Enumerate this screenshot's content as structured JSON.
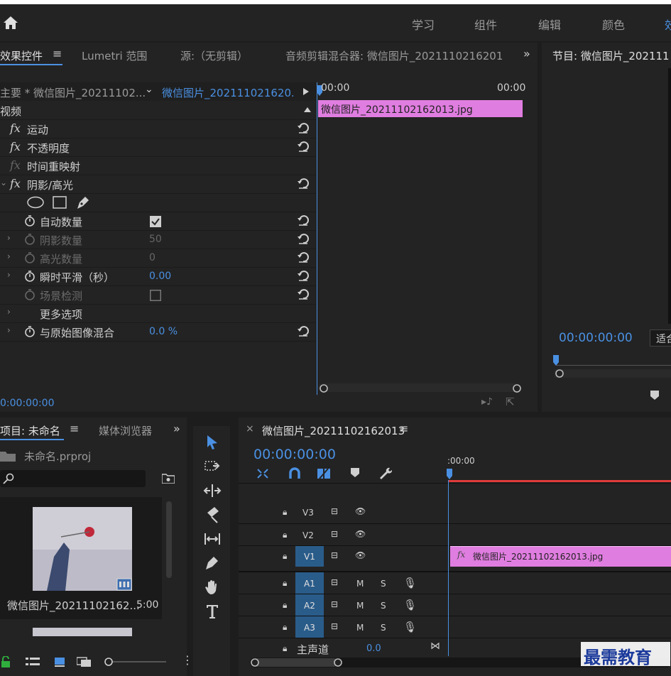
{
  "workspaces": [
    "学习",
    "组件",
    "编辑",
    "颜色",
    "效"
  ],
  "effect_panel": {
    "tabs": [
      "效果控件",
      "Lumetri 范围",
      "源:（无剪辑）",
      "音频剪辑混合器: 微信图片_2021110216201"
    ],
    "master_clip": "主要 * 微信图片_20211102...",
    "sequence_clip": "微信图片_202111021620...",
    "section_video": "视频",
    "effects": [
      {
        "name": "运动"
      },
      {
        "name": "不透明度"
      },
      {
        "name": "时间重映射"
      },
      {
        "name": "阴影/高光"
      }
    ],
    "params": [
      {
        "name": "自动数量",
        "value": ""
      },
      {
        "name": "阴影数量",
        "value": "50"
      },
      {
        "name": "高光数量",
        "value": "0"
      },
      {
        "name": "瞬时平滑（秒）",
        "value": "0.00"
      },
      {
        "name": "场景检测",
        "value": ""
      },
      {
        "name": "更多选项",
        "value": ""
      },
      {
        "name": "与原始图像混合",
        "value": "0.0 %"
      }
    ],
    "timeline_start": "00:00",
    "timeline_end": "00:00",
    "clip_name": "微信图片_20211102162013.jpg",
    "timecode": "0:00:00:00"
  },
  "program": {
    "title": "节目: 微信图片_202111",
    "timecode": "00:00:00:00",
    "fit": "适合"
  },
  "project": {
    "tabs": [
      "项目: 未命名",
      "媒体浏览器"
    ],
    "file": "未命名.prproj",
    "item_name": "微信图片_20211102162...",
    "item_duration": "5:00"
  },
  "timeline": {
    "title": "微信图片_20211102162013",
    "timecode": "00:00:00:00",
    "ruler_start": ":00:00",
    "tracks": [
      {
        "label": "V3"
      },
      {
        "label": "V2"
      },
      {
        "label": "V1"
      },
      {
        "label": "A1",
        "m": "M",
        "s": "S"
      },
      {
        "label": "A2",
        "m": "M",
        "s": "S"
      },
      {
        "label": "A3",
        "m": "M",
        "s": "S"
      }
    ],
    "master": "主声道",
    "master_value": "0.0",
    "clip_name": "微信图片_20211102162013.jpg"
  },
  "watermark": "最需教育",
  "colors": {
    "accent": "#4a90e2",
    "clip_pink": "#e07de0",
    "playhead_red": "#e03a3a"
  }
}
